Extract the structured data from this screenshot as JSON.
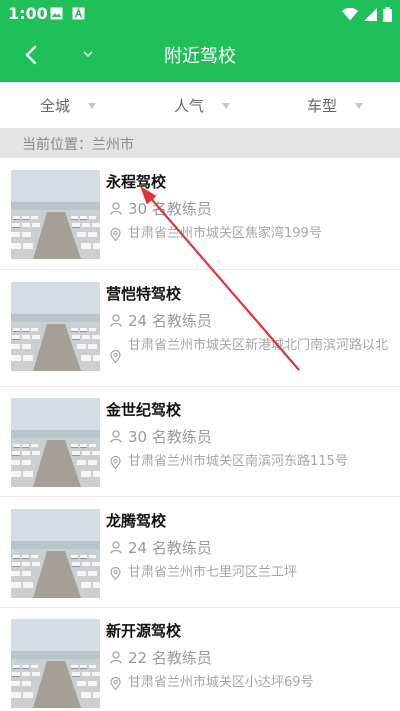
{
  "status_bar": {
    "time": "1:00"
  },
  "header": {
    "title": "附近驾校"
  },
  "filters": [
    {
      "label": "全城"
    },
    {
      "label": "人气"
    },
    {
      "label": "车型"
    }
  ],
  "location": {
    "text": "当前位置：兰州市"
  },
  "schools": [
    {
      "name": "永程驾校",
      "coaches": "30 名教练员",
      "address": "甘肃省兰州市城关区焦家湾199号"
    },
    {
      "name": "营恺特驾校",
      "coaches": "24 名教练员",
      "address": "甘肃省兰州市城关区新港城北门南滨河路以北"
    },
    {
      "name": "金世纪驾校",
      "coaches": "30 名教练员",
      "address": "甘肃省兰州市城关区南滨河东路115号"
    },
    {
      "name": "龙腾驾校",
      "coaches": "24 名教练员",
      "address": "甘肃省兰州市七里河区兰工坪"
    },
    {
      "name": "新开源驾校",
      "coaches": "22 名教练员",
      "address": "甘肃省兰州市城关区小达坪69号"
    }
  ],
  "colors": {
    "primary": "#1fbf5a",
    "annotation_arrow": "#d9383a"
  }
}
